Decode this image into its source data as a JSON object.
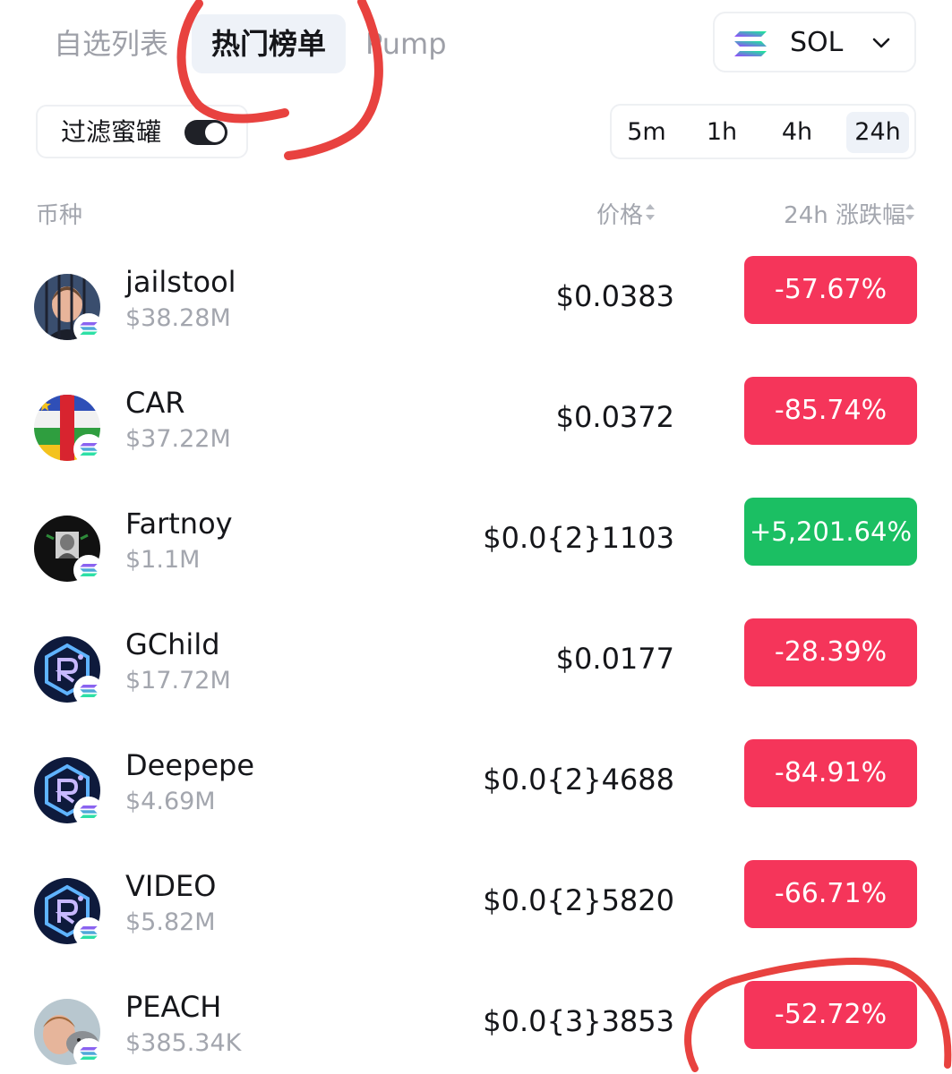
{
  "tabs": [
    {
      "label": "自选列表",
      "active": false
    },
    {
      "label": "热门榜单",
      "active": true
    },
    {
      "label": "Pump",
      "active": false
    }
  ],
  "chain_selector": {
    "label": "SOL",
    "icon": "solana-icon"
  },
  "filter": {
    "label": "过滤蜜罐",
    "enabled": true
  },
  "timeframes": [
    {
      "label": "5m",
      "active": false
    },
    {
      "label": "1h",
      "active": false
    },
    {
      "label": "4h",
      "active": false
    },
    {
      "label": "24h",
      "active": true
    }
  ],
  "columns": {
    "coin": "币种",
    "price": "价格",
    "change": "24h 涨跌幅"
  },
  "tokens": [
    {
      "name": "jailstool",
      "mcap": "$38.28M",
      "price": "$0.0383",
      "change": "-57.67%",
      "direction": "down"
    },
    {
      "name": "CAR",
      "mcap": "$37.22M",
      "price": "$0.0372",
      "change": "-85.74%",
      "direction": "down"
    },
    {
      "name": "Fartnoy",
      "mcap": "$1.1M",
      "price": "$0.0{2}1103",
      "change": "+5,201.64%",
      "direction": "up"
    },
    {
      "name": "GChild",
      "mcap": "$17.72M",
      "price": "$0.0177",
      "change": "-28.39%",
      "direction": "down"
    },
    {
      "name": "Deepepe",
      "mcap": "$4.69M",
      "price": "$0.0{2}4688",
      "change": "-84.91%",
      "direction": "down"
    },
    {
      "name": "VIDEO",
      "mcap": "$5.82M",
      "price": "$0.0{2}5820",
      "change": "-66.71%",
      "direction": "down"
    },
    {
      "name": "PEACH",
      "mcap": "$385.34K",
      "price": "$0.0{3}3853",
      "change": "-52.72%",
      "direction": "down"
    }
  ],
  "colors": {
    "down": "#f5355a",
    "up": "#1bbf63",
    "annotation": "#e8423f",
    "active_bg": "#eef2f8"
  }
}
